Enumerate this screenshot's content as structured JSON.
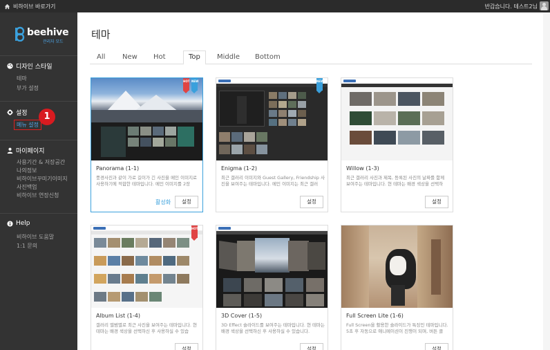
{
  "topbar": {
    "home_label": "비하이브 바로가기",
    "user_greeting": "반갑습니다. 테스트2님"
  },
  "sidebar": {
    "logo_text": "beehive",
    "logo_sub": "관리자 모드",
    "sections": [
      {
        "title": "디자인 스타일",
        "icon": "palette-icon",
        "items": [
          "테마",
          "부가 설정"
        ]
      },
      {
        "title": "설정",
        "icon": "gear-icon",
        "items": [
          "메뉴 설정"
        ]
      },
      {
        "title": "마이페이지",
        "icon": "user-icon",
        "items": [
          "사용기간 & 저장공간",
          "나의정보",
          "비하이브꾸미기이미지",
          "사진백업",
          "비하이브 연장신청"
        ]
      },
      {
        "title": "Help",
        "icon": "info-icon",
        "items": [
          "비하이브 도움말",
          "1:1 문의"
        ]
      }
    ],
    "step_badge": "1"
  },
  "main": {
    "title": "테마",
    "tabs": [
      "All",
      "New",
      "Hot",
      "Top",
      "Middle",
      "Bottom"
    ],
    "active_tab": "Top",
    "activate_label": "활성화",
    "settings_label": "설정",
    "ribbon_hot": "HOT",
    "ribbon_new": "NEW",
    "themes": [
      {
        "title": "Panorama (1-1)",
        "desc": "풍경사진과 같이 가로 길이가 긴 사진을 메인 이미지로 사용하기에 적합한 테마입니다. 메인 이미지를 2장"
      },
      {
        "title": "Enigma (1-2)",
        "desc": "최근 갤러리 이미지와 Guest Gallery, Friendship 사진을 보여주는 테마입니다. 메인 이미지는 최근 갤러"
      },
      {
        "title": "Willow (1-3)",
        "desc": "최근 갤러리 사진과 제목, 등록된 사진의 날짜를 함께 보여주는 테마입니다. 현 테마는 배경 색상을 선택하"
      },
      {
        "title": "Album List (1-4)",
        "desc": "갤러리 앨범별로 최근 사진을 보여주는 테마입니다. 현 테마는 배경 색상을 선택하신 후 사용하실 수 있습"
      },
      {
        "title": "3D Cover (1-5)",
        "desc": "3D Effect 슬라이드를 보여주는 테마입니다. 현 테마는 배경 색상을 선택하신 후 사용하실 수 있습니다."
      },
      {
        "title": "Full Screen Lite (1-6)",
        "desc": "Full Screen을 활용한 슬라이드가 특징인 테마입니다. 5초 후 자동으로 애니메이션이 진행이 되며, 버튼 클"
      }
    ]
  },
  "colors": {
    "sidebar_bg": "#333333",
    "topbar_bg": "#2b2b2b",
    "accent": "#3aa0dc",
    "badge": "#d81b20"
  }
}
